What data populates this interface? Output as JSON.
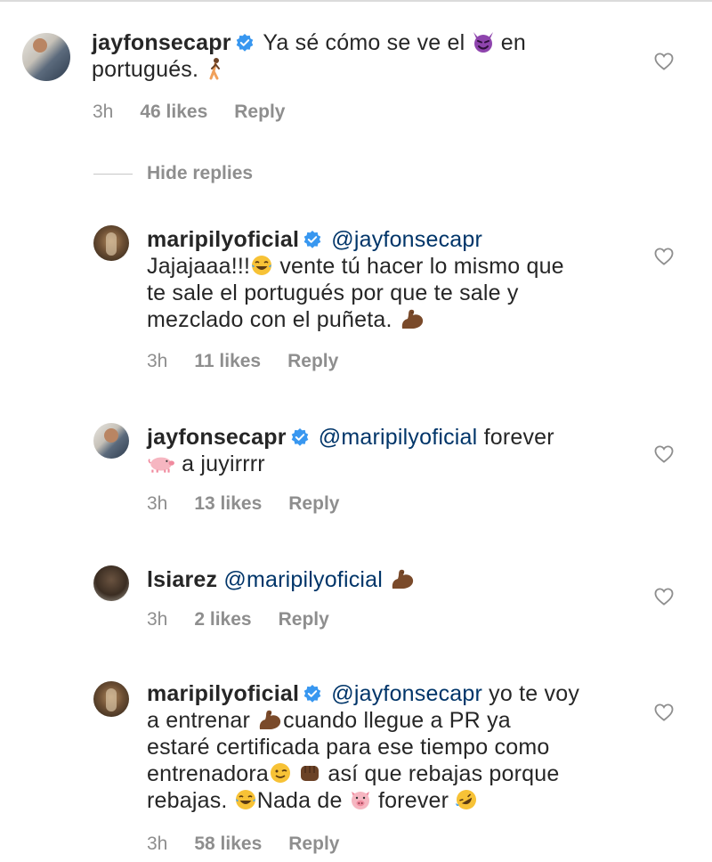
{
  "comments": [
    {
      "username": "jayfonsecapr",
      "line1": "Ya sé cómo se ve el",
      "line1b": "en",
      "line2": "portugués.",
      "time": "3h",
      "likes": "46 likes",
      "reply": "Reply"
    },
    {
      "username": "maripilyoficial",
      "mention": "@jayfonsecapr",
      "line1": "Jajajaaa!!!",
      "line1b": "vente tú hacer lo mismo que",
      "line2": "te sale el portugués por que te sale y",
      "line3": "mezclado con el puñeta.",
      "time": "3h",
      "likes": "11 likes",
      "reply": "Reply"
    },
    {
      "username": "jayfonsecapr",
      "mention": "@maripilyoficial",
      "line1b": "forever",
      "line2": "a juyirrrr",
      "time": "3h",
      "likes": "13 likes",
      "reply": "Reply"
    },
    {
      "username": "lsiarez",
      "mention": "@maripilyoficial",
      "time": "3h",
      "likes": "2 likes",
      "reply": "Reply"
    },
    {
      "username": "maripilyoficial",
      "mention": "@jayfonsecapr",
      "line1b": "yo te voy",
      "line2a": "a entrenar",
      "line2b": "cuando llegue a PR ya",
      "line3": "estaré certificada para ese tiempo como",
      "line4a": "entrenadora",
      "line4b": "así que rebajas porque",
      "line5a": "rebajas.",
      "line5b": "Nada de",
      "line5c": "forever",
      "time": "3h",
      "likes": "58 likes",
      "reply": "Reply"
    }
  ],
  "hide_replies": "Hide replies",
  "colors": {
    "mention": "#003569",
    "muted": "#8e8e8e",
    "verified": "#3897f0"
  },
  "icons": [
    "heart-outline-icon",
    "verified-badge-icon",
    "devil-emoji",
    "walking-emoji",
    "laughing-tears-emoji",
    "flexed-biceps-emoji",
    "pig-emoji",
    "pig-face-emoji",
    "winking-emoji",
    "fist-emoji",
    "rofl-emoji"
  ]
}
